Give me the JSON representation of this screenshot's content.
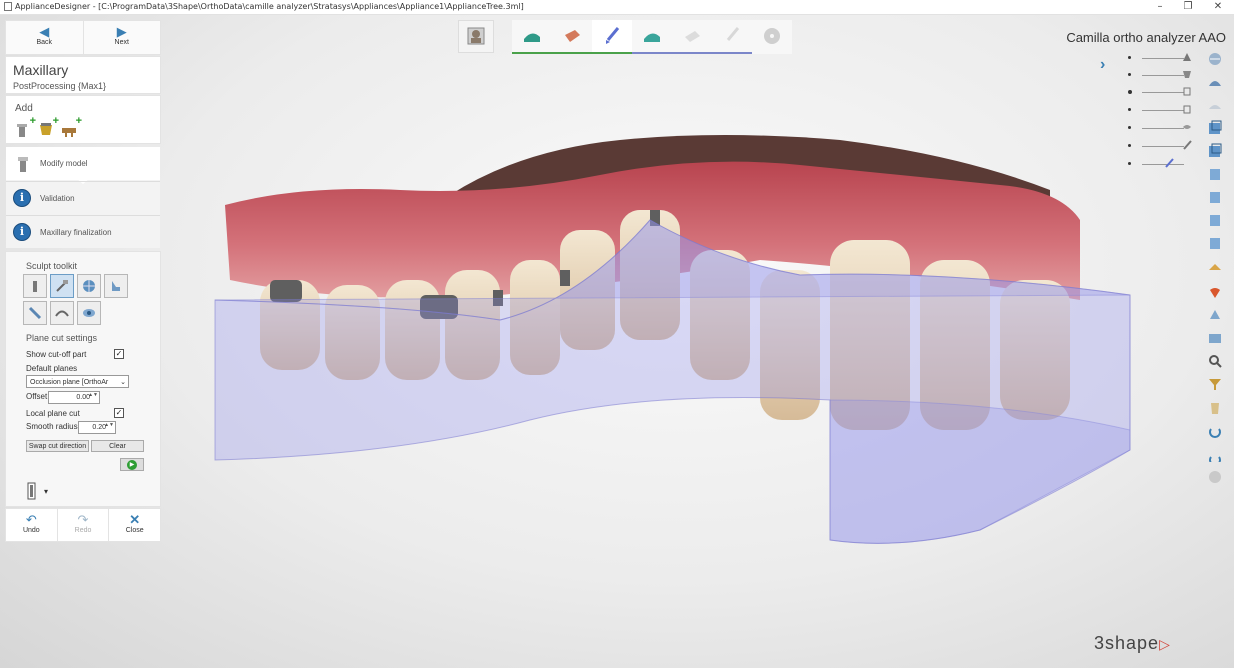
{
  "window": {
    "title": "ApplianceDesigner - [C:\\ProgramData\\3Shape\\OrthoData\\camille analyzer\\Stratasys\\Appliances\\Appliance1\\ApplianceTree.3ml]",
    "minimize": "–",
    "maximize": "❐",
    "close": "✕"
  },
  "nav": {
    "back_label": "Back",
    "next_label": "Next",
    "back_icon": "◀",
    "next_icon": "▶"
  },
  "model": {
    "title": "Maxillary",
    "subtitle": "PostProcessing {Max1}"
  },
  "add": {
    "label": "Add",
    "plus": "+"
  },
  "workflow_steps": [
    {
      "label": "Modify model"
    },
    {
      "label": "Validation",
      "icon": "i"
    },
    {
      "label": "Maxillary finalization",
      "icon": "i"
    }
  ],
  "sculpt": {
    "title": "Sculpt toolkit",
    "plane_cut_title": "Plane cut settings",
    "show_cutoff_label": "Show cut-off part",
    "show_cutoff_checked": "✓",
    "default_planes_label": "Default planes",
    "plane_select_value": "Occlusion plane [OrthoAr",
    "select_arrow": "⌄",
    "offset_label": "Offset",
    "offset_value": "0.00",
    "local_plane_cut_label": "Local plane cut",
    "local_plane_cut_checked": "✓",
    "smooth_radius_label": "Smooth radius",
    "smooth_radius_value": "0.20",
    "spin_arrows": "▲▼",
    "swap_label": "Swap cut direction",
    "clear_label": "Clear",
    "go_icon": "▶",
    "tool_dropdown_arrow": "▾"
  },
  "actions": {
    "undo_label": "Undo",
    "redo_label": "Redo",
    "close_label": "Close",
    "undo_icon": "↶",
    "redo_icon": "↷",
    "close_icon": "✕"
  },
  "project": {
    "name": "Camilla ortho analyzer AAO",
    "expand_icon": "›"
  },
  "brand": {
    "name": "3shape",
    "mark": "▷"
  },
  "colors": {
    "accent": "#3a7fb3",
    "gum": "#c8636e",
    "aligner": "#8f8ee6",
    "tray_step": "#3a9e86",
    "done_underline": "#4aa14a",
    "todo_underline": "#7b86c9"
  }
}
